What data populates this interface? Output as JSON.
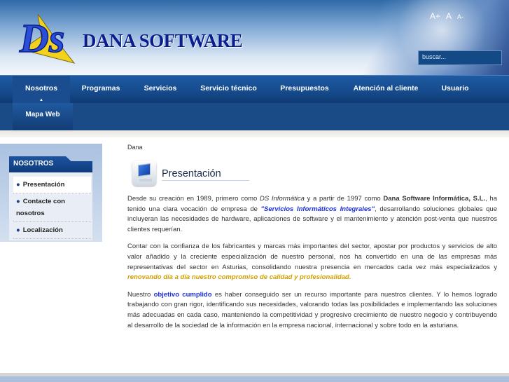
{
  "header": {
    "brand": "DANA SOFTWARE",
    "logo_text": "DS",
    "font_controls": [
      "A+",
      "A",
      "A-"
    ],
    "search_placeholder": "buscar..."
  },
  "nav": {
    "items": [
      "Nosotros",
      "Programas",
      "Servicios",
      "Servicio técnico",
      "Presupuestos",
      "Atención al cliente",
      "Usuario"
    ],
    "active": "Nosotros",
    "sub": [
      "Mapa Web"
    ]
  },
  "sidebar": {
    "title": "NOSOTROS",
    "items": [
      "Presentación",
      "Contacte con nosotros",
      "Localización"
    ]
  },
  "content": {
    "breadcrumb": "Dana",
    "title": "Presentación",
    "p1": {
      "a": "Desde su creación en 1989, primero como ",
      "b": "DS Informática",
      "c": " y a partir de 1997  como ",
      "d": "Dana Software Informática, S.L.",
      "e": ", ha tenido una clara vocación de empresa de ",
      "f": "\"Servicios Informáticos Integrales\"",
      "g": ", desarrollando soluciones globales que incluyeran las necesidades de hardware, aplicaciones de software y el mantenimiento y atención post-venta que nuestros clientes requerían."
    },
    "p2": {
      "a": "Contar con la confianza de los fabricantes y marcas más importantes del sector, apostar por productos y servicios de alto valor añadido y la creciente especialización de nuestro personal, nos ha convertido en una de las empresas más representativas del sector en  Asturias, consolidando nuestra presencia en mercados cada vez más especializados y ",
      "b": "renovando día a día nuestro compromiso de calidad  y profesionalidad."
    },
    "p3": {
      "a": "Nuestro ",
      "b": "objetivo cumplido",
      "c": " es haber conseguido ser un recurso importante para nuestros clientes. Y lo hemos logrado  trabajando con gran rigor, identificando sus necesidades, valorando todas las posibilidades e implementando las soluciones más adecuadas en cada caso, manteniendo la competitividad y progresivo crecimiento de nuestro negocio y contribuyendo al desarrollo de la sociedad de la información en la empresa  nacional, internacional y sobre todo en la asturiana."
    }
  },
  "colors": {
    "nav": "#154a8c",
    "link_blue": "#1a2ee0",
    "highlight_gold": "#d1a000"
  }
}
